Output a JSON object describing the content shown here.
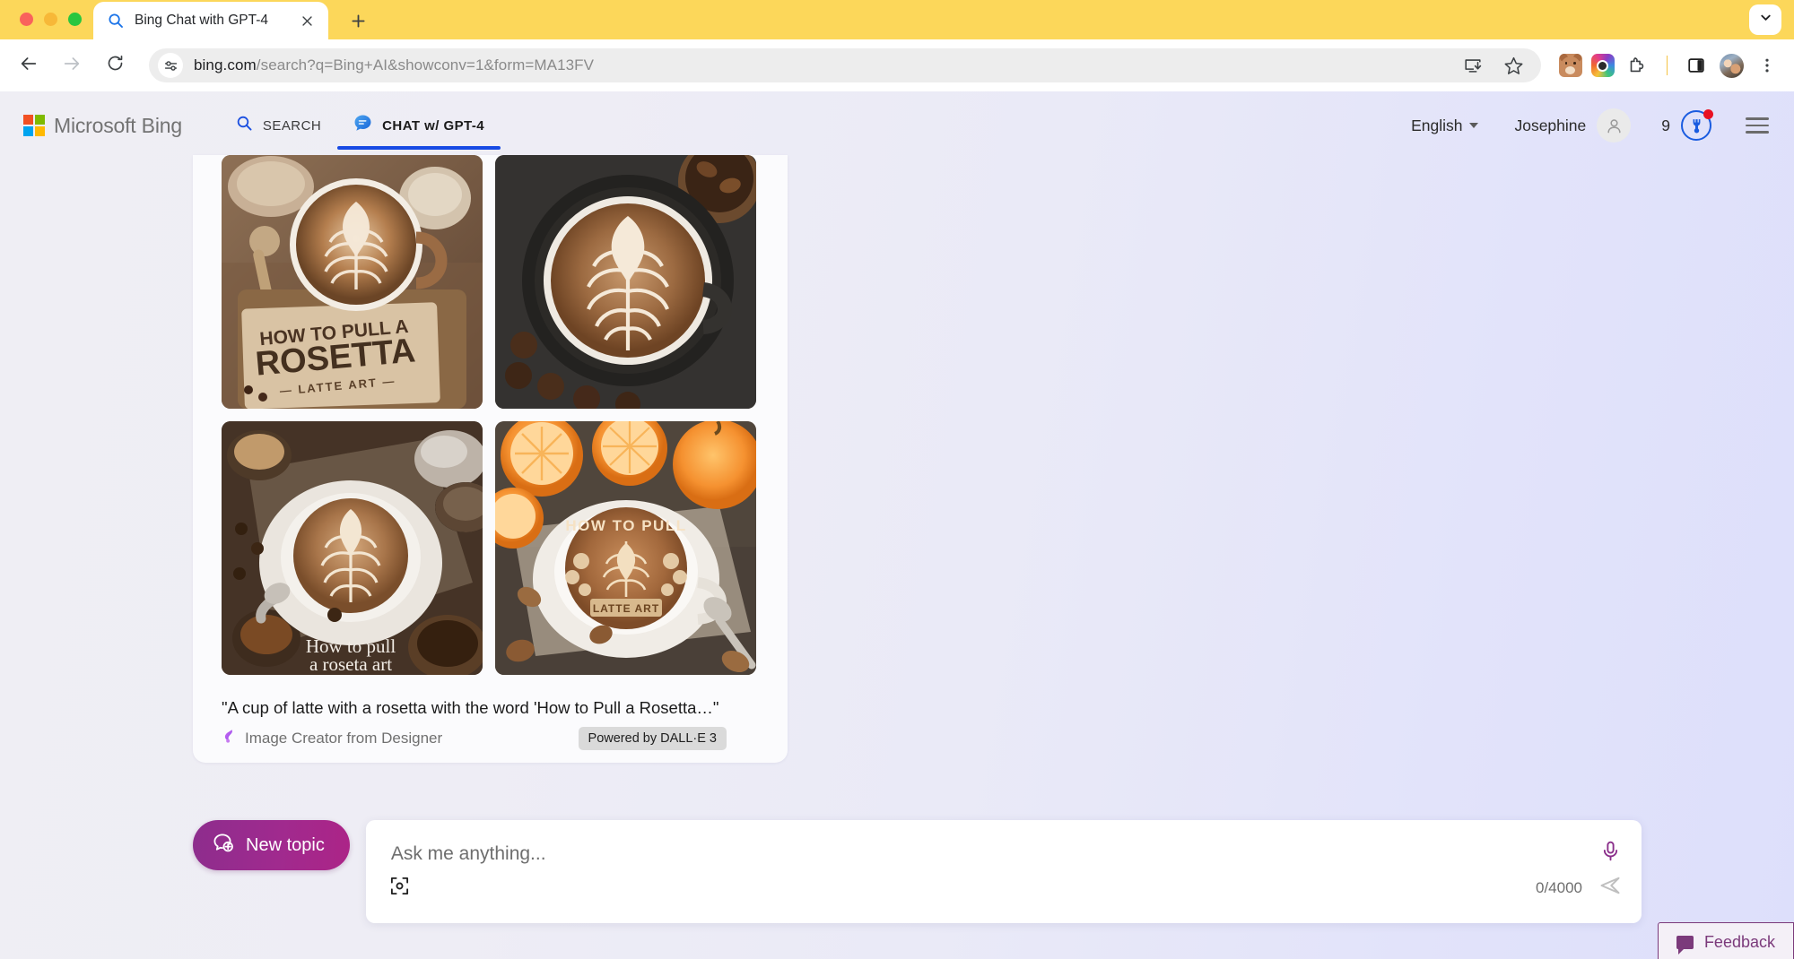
{
  "browser": {
    "window_controls": [
      "close",
      "minimize",
      "maximize"
    ],
    "tab": {
      "title": "Bing Chat with GPT-4",
      "favicon": "search-icon",
      "close_label": "×"
    },
    "new_tab_label": "+",
    "tab_list_chevron": "chevron-down-icon",
    "nav": {
      "back": "back-arrow-icon",
      "forward": "forward-arrow-icon",
      "reload": "reload-icon"
    },
    "omnibox": {
      "site_info_icon": "site-settings-icon",
      "url_domain": "bing.com",
      "url_path": "/search?q=Bing+AI&showconv=1&form=MA13FV",
      "full_url": "bing.com/search?q=Bing+AI&showconv=1&form=MA13FV"
    },
    "actions": {
      "install": "install-app-icon",
      "bookmark": "star-icon",
      "ext_bear": "bear-extension-icon",
      "ext_camera": "camera-extension-icon",
      "extensions": "puzzle-piece-icon",
      "side_panel": "side-panel-icon",
      "profile": "profile-avatar",
      "menu": "kebab-menu-icon"
    }
  },
  "bing": {
    "logo_text": "Microsoft Bing",
    "tabs": [
      {
        "label": "SEARCH",
        "icon": "magnifier-icon",
        "active": false
      },
      {
        "label": "CHAT w/ GPT-4",
        "icon": "chat-bubble-icon",
        "active": true
      }
    ],
    "language": "English",
    "user_name": "Josephine",
    "rewards_count": "9",
    "rewards_icon": "rewards-medal-icon",
    "has_notification": true,
    "menu_icon": "hamburger-menu-icon",
    "accent_blue": "#174AE4",
    "accent_purple": "#8D2D8D"
  },
  "message": {
    "caption": "\"A cup of latte with a rosetta with the word 'How to Pull a Rosetta…\"",
    "attribution": "Image Creator from Designer",
    "attribution_icon": "designer-icon",
    "badge": "Powered by DALL·E 3",
    "images": [
      {
        "alt": "Latte with rosetta art on a kraft card reading HOW TO PULL A ROSETTA LATTE ART",
        "overlay_line1": "HOW TO PULL A",
        "overlay_line2": "ROSETTA",
        "overlay_line3": "LATTE ART"
      },
      {
        "alt": "Overhead dark cup of latte with white heart rosetta and coffee beans",
        "overlay_line1": "",
        "overlay_line2": "",
        "overlay_line3": ""
      },
      {
        "alt": "Flat lay latte rosetta with spoon, beans and sugar bowls",
        "overlay_line1": "How to pull",
        "overlay_line2": "a roseta art",
        "overlay_line3": ""
      },
      {
        "alt": "Latte rosetta with ornate lettering surrounded by oranges and nuts",
        "overlay_line1": "HOW TO PULL",
        "overlay_line2": "LATTE ART",
        "overlay_line3": ""
      }
    ]
  },
  "composer": {
    "new_topic_label": "New topic",
    "new_topic_icon": "new-topic-icon",
    "placeholder": "Ask me anything...",
    "value": "",
    "char_count": "0/4000",
    "visual_search_icon": "visual-search-icon",
    "mic_icon": "microphone-icon",
    "send_icon": "send-arrow-icon"
  },
  "feedback": {
    "label": "Feedback",
    "icon": "feedback-bubble-icon"
  }
}
